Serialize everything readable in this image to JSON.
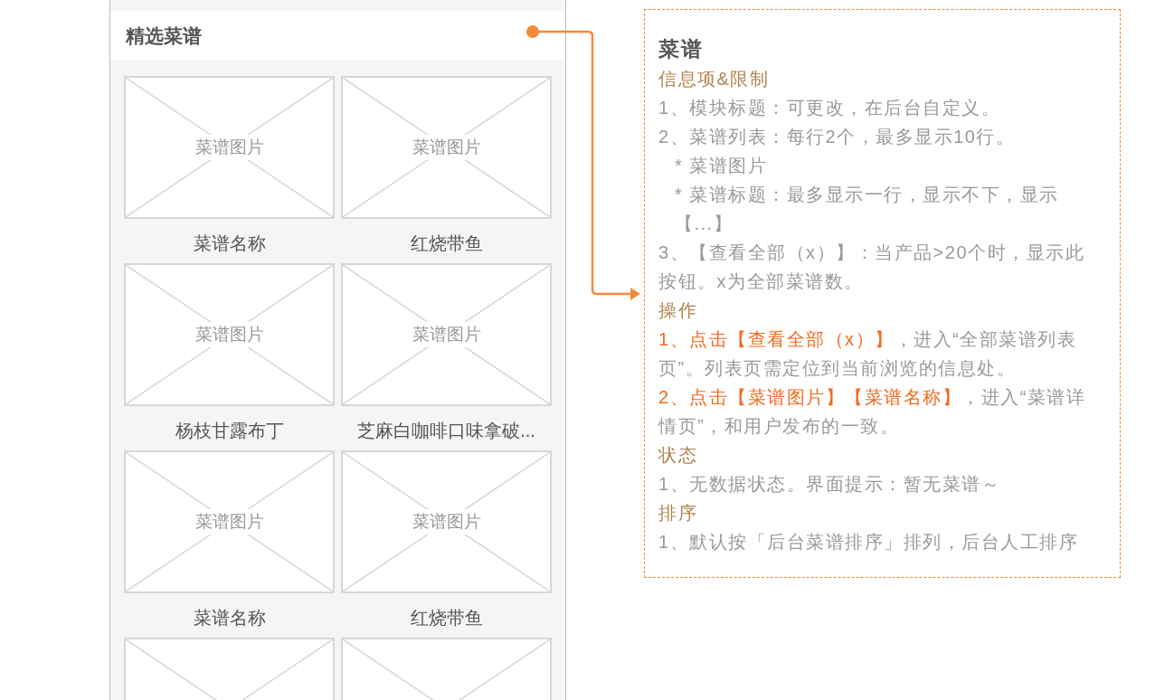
{
  "module": {
    "title": "精选菜谱",
    "recipes": [
      {
        "image_label": "菜谱图片",
        "name": "菜谱名称"
      },
      {
        "image_label": "菜谱图片",
        "name": "红烧带鱼"
      },
      {
        "image_label": "菜谱图片",
        "name": "杨枝甘露布丁"
      },
      {
        "image_label": "菜谱图片",
        "name": "芝麻白咖啡口味拿破..."
      },
      {
        "image_label": "菜谱图片",
        "name": "菜谱名称"
      },
      {
        "image_label": "菜谱图片",
        "name": "红烧带鱼"
      }
    ],
    "list_continues": true
  },
  "annotation": {
    "title": "菜谱",
    "lines": [
      {
        "kind": "heading",
        "text": "信息项&限制"
      },
      {
        "kind": "text",
        "text": "1、模块标题：可更改，在后台自定义。"
      },
      {
        "kind": "text",
        "text": "2、菜谱列表：每行2个，最多显示10行。"
      },
      {
        "kind": "sub",
        "text": "* 菜谱图片"
      },
      {
        "kind": "sub",
        "text": "* 菜谱标题：最多显示一行，显示不下，显示【...】"
      },
      {
        "kind": "text",
        "text": "3、【查看全部（x）】：当产品>20个时，显示此按钮。x为全部菜谱数。"
      },
      {
        "kind": "heading",
        "text": "操作"
      },
      {
        "kind": "action",
        "highlight": "1、点击【查看全部（x）】",
        "text": "，进入“全部菜谱列表页”。列表页需定位到当前浏览的信息处。"
      },
      {
        "kind": "action",
        "highlight": "2、点击【菜谱图片】【菜谱名称】",
        "text": "，进入“菜谱详情页”，和用户发布的一致。"
      },
      {
        "kind": "heading",
        "text": "状态"
      },
      {
        "kind": "text",
        "text": "1、无数据状态。界面提示：暂无菜谱～"
      },
      {
        "kind": "heading",
        "text": "排序"
      },
      {
        "kind": "text",
        "text": "1、默认按「后台菜谱排序」排列，后台人工排序"
      }
    ]
  }
}
